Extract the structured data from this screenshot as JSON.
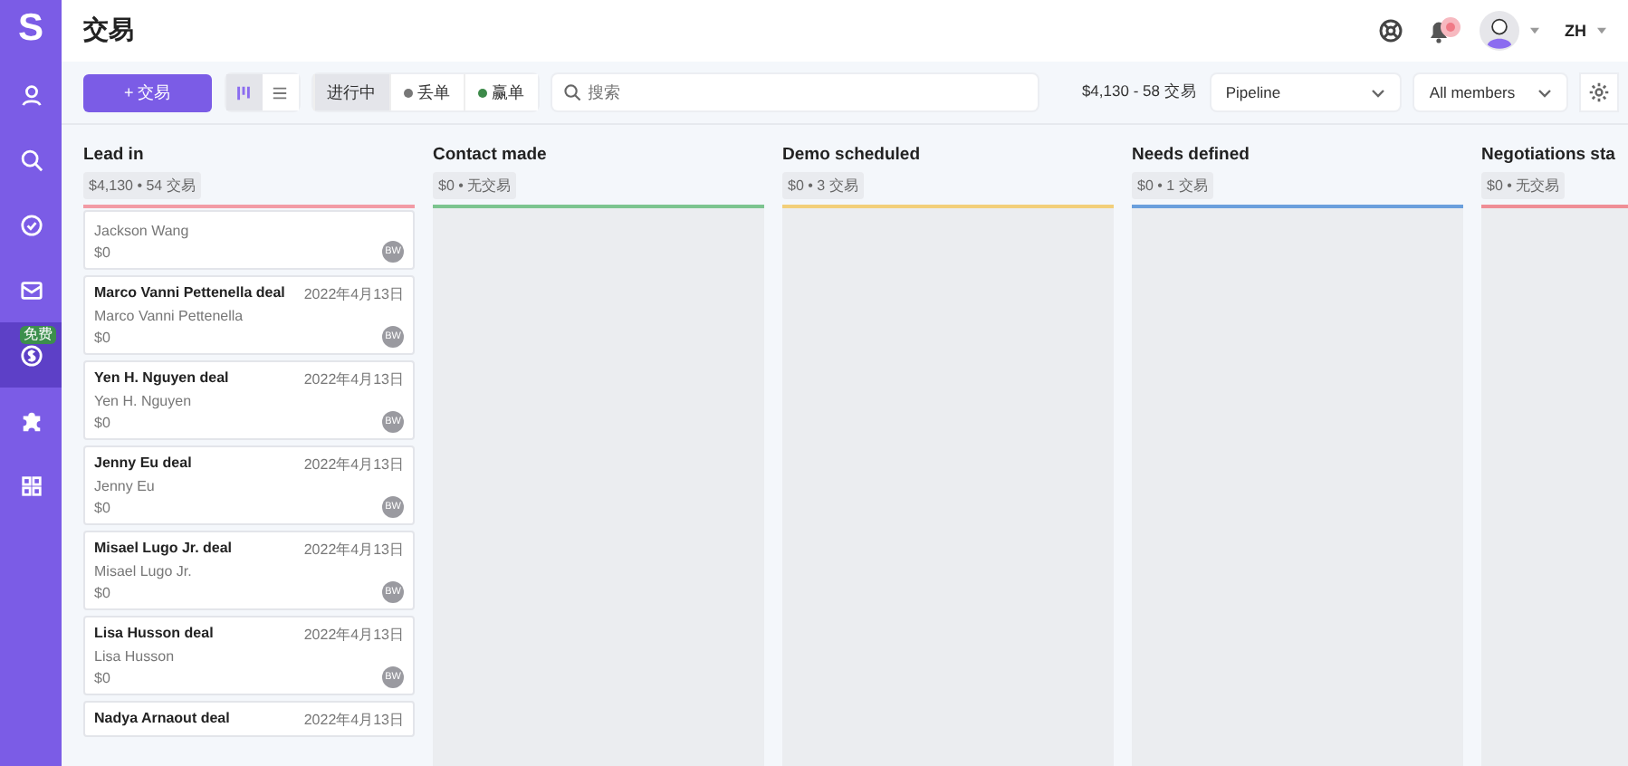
{
  "sidebar": {
    "logo": "S",
    "items": [
      {
        "kind": "person",
        "selected": false
      },
      {
        "kind": "search",
        "selected": false
      },
      {
        "kind": "check",
        "selected": false
      },
      {
        "kind": "mail",
        "selected": false
      },
      {
        "kind": "dollar",
        "selected": true,
        "badge": "免费"
      },
      {
        "kind": "puzzle",
        "selected": false
      },
      {
        "kind": "grid",
        "selected": false
      }
    ]
  },
  "header": {
    "title": "交易",
    "language": "ZH"
  },
  "toolbar": {
    "add_button": "+ 交易",
    "views": [
      {
        "kind": "board",
        "selected": true
      },
      {
        "kind": "list",
        "selected": false
      }
    ],
    "status_filters": [
      {
        "label": "进行中",
        "selected": true
      },
      {
        "label": "丢单",
        "selected": false,
        "color": "#777777"
      },
      {
        "label": "赢单",
        "selected": false,
        "color": "#3d8a4a"
      }
    ],
    "search": {
      "placeholder": "搜索"
    },
    "summary": "$4,130 - 58 交易",
    "pipeline": "Pipeline",
    "members": "All members"
  },
  "stages": [
    {
      "name": "Lead in",
      "summary": "$4,130 • 54 交易",
      "color": "#f29ba5",
      "deals": [
        {
          "person": "Jackson Wang",
          "value": "$0",
          "owner": "BW"
        },
        {
          "title": "Marco Vanni Pettenella deal",
          "date": "2022年4月13日",
          "person": "Marco Vanni Pettenella",
          "value": "$0",
          "owner": "BW"
        },
        {
          "title": "Yen H. Nguyen deal",
          "date": "2022年4月13日",
          "person": "Yen H. Nguyen",
          "value": "$0",
          "owner": "BW"
        },
        {
          "title": "Jenny Eu deal",
          "date": "2022年4月13日",
          "person": "Jenny Eu",
          "value": "$0",
          "owner": "BW"
        },
        {
          "title": "Misael Lugo Jr. deal",
          "date": "2022年4月13日",
          "person": "Misael Lugo Jr.",
          "value": "$0",
          "owner": "BW"
        },
        {
          "title": "Lisa Husson deal",
          "date": "2022年4月13日",
          "person": "Lisa Husson",
          "value": "$0",
          "owner": "BW"
        },
        {
          "title": "Nadya Arnaout deal",
          "date": "2022年4月13日"
        }
      ]
    },
    {
      "name": "Contact made",
      "summary": "$0 • 无交易",
      "color": "#7cc48f"
    },
    {
      "name": "Demo scheduled",
      "summary": "$0 • 3 交易",
      "color": "#f2cf7a"
    },
    {
      "name": "Needs defined",
      "summary": "$0 • 1 交易",
      "color": "#6a9fdc"
    },
    {
      "name": "Negotiations sta",
      "summary": "$0 • 无交易",
      "color": "#ef8e96"
    }
  ]
}
